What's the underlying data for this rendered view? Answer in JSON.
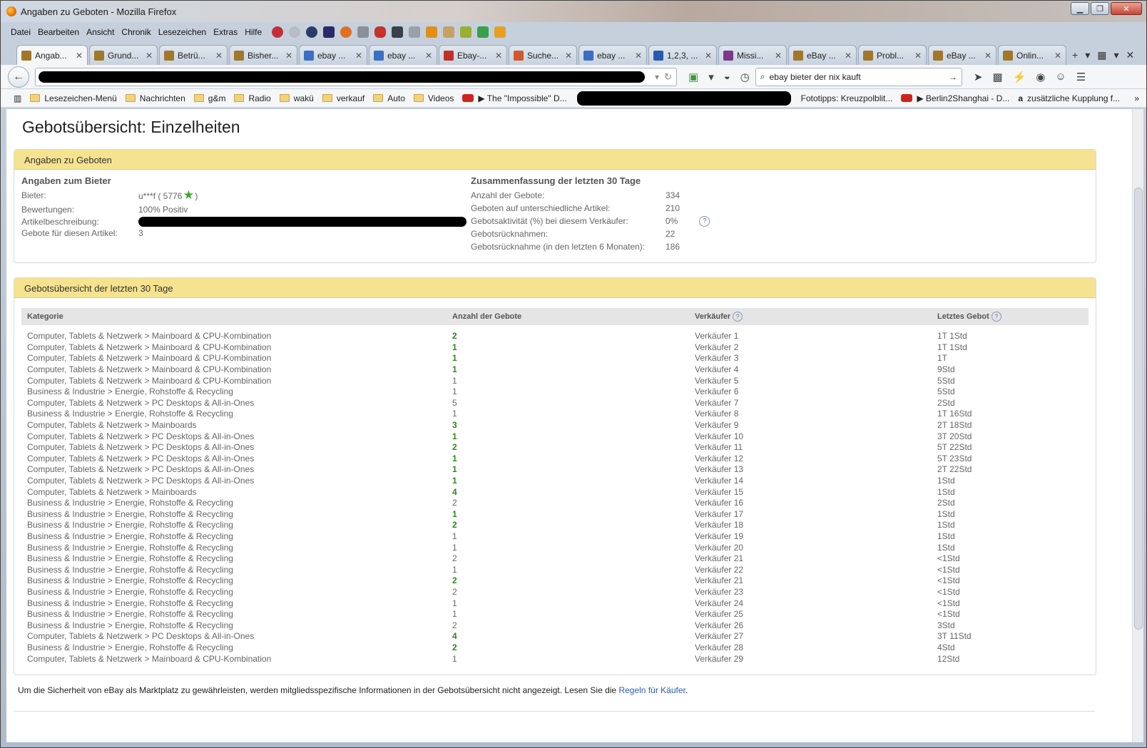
{
  "window": {
    "title": "Angaben zu Geboten - Mozilla Firefox"
  },
  "menu": [
    "Datei",
    "Bearbeiten",
    "Ansicht",
    "Chronik",
    "Lesezeichen",
    "Extras",
    "Hilfe"
  ],
  "tabs": [
    {
      "label": "Angab...",
      "color": "#a0782a",
      "active": true
    },
    {
      "label": "Grund...",
      "color": "#a0782a"
    },
    {
      "label": "Betrü...",
      "color": "#a0782a"
    },
    {
      "label": "Bisher...",
      "color": "#a0782a"
    },
    {
      "label": "ebay ...",
      "color": "#3a6fc4"
    },
    {
      "label": "ebay ...",
      "color": "#3a6fc4"
    },
    {
      "label": "Ebay-...",
      "color": "#c0302a"
    },
    {
      "label": "Suche...",
      "color": "#d05a2a"
    },
    {
      "label": "ebay ...",
      "color": "#3a6fc4"
    },
    {
      "label": "1,2,3, ...",
      "color": "#2a5ab0"
    },
    {
      "label": "Missi...",
      "color": "#7a3a8a"
    },
    {
      "label": "eBay ...",
      "color": "#a0782a"
    },
    {
      "label": "Probl...",
      "color": "#a0782a"
    },
    {
      "label": "eBay ...",
      "color": "#a0782a"
    },
    {
      "label": "Onlin...",
      "color": "#a0782a"
    }
  ],
  "search": {
    "value": "ebay bieter der nix kauft"
  },
  "bookmarks": [
    {
      "label": "Lesezeichen-Menü",
      "type": "folder"
    },
    {
      "label": "Nachrichten",
      "type": "folder"
    },
    {
      "label": "g&m",
      "type": "folder"
    },
    {
      "label": "Radio",
      "type": "folder"
    },
    {
      "label": "wakü",
      "type": "folder"
    },
    {
      "label": "verkauf",
      "type": "folder"
    },
    {
      "label": "Auto",
      "type": "folder"
    },
    {
      "label": "Videos",
      "type": "folder"
    },
    {
      "label": "▶ The \"Impossible\" D...",
      "type": "youtube"
    }
  ],
  "bookmarks_right": [
    {
      "label": "Fototipps: Kreuzpolblit...",
      "type": "plain"
    },
    {
      "label": "▶ Berlin2Shanghai - D...",
      "type": "youtube"
    },
    {
      "label": "zusätzliche Kupplung f...",
      "type": "amazon"
    }
  ],
  "page": {
    "title": "Gebotsübersicht: Einzelheiten",
    "panel1_title": "Angaben zu Geboten",
    "bidder": {
      "heading": "Angaben zum Bieter",
      "bieter_label": "Bieter:",
      "bieter_value": "u***f ( 5776",
      "bieter_close": ")",
      "bewertungen_label": "Bewertungen:",
      "bewertungen_value": "100% Positiv",
      "artikel_label": "Artikelbeschreibung:",
      "gebote_label": "Gebote für diesen Artikel:",
      "gebote_value": "3"
    },
    "summary": {
      "heading": "Zusammenfassung der letzten 30 Tage",
      "rows": [
        {
          "label": "Anzahl der Gebote:",
          "value": "334"
        },
        {
          "label": "Geboten auf unterschiedliche Artikel:",
          "value": "210"
        },
        {
          "label": "Gebotsaktivität (%) bei diesem Verkäufer:",
          "value": "0%"
        },
        {
          "label": "Gebotsrücknahmen:",
          "value": "22"
        },
        {
          "label": "Gebotsrücknahme (in den letzten 6 Monaten):",
          "value": "186"
        }
      ]
    },
    "panel2_title": "Gebotsübersicht der letzten 30 Tage",
    "table": {
      "headers": [
        "Kategorie",
        "Anzahl der Gebote",
        "Verkäufer",
        "Letztes Gebot"
      ],
      "rows": [
        [
          "Computer, Tablets & Netzwerk > Mainboard & CPU-Kombination",
          "2",
          "Verkäufer 1",
          "1T 1Std",
          true
        ],
        [
          "Computer, Tablets & Netzwerk > Mainboard & CPU-Kombination",
          "1",
          "Verkäufer 2",
          "1T 1Std",
          true
        ],
        [
          "Computer, Tablets & Netzwerk > Mainboard & CPU-Kombination",
          "1",
          "Verkäufer 3",
          "1T",
          true
        ],
        [
          "Computer, Tablets & Netzwerk > Mainboard & CPU-Kombination",
          "1",
          "Verkäufer 4",
          "9Std",
          true
        ],
        [
          "Computer, Tablets & Netzwerk > Mainboard & CPU-Kombination",
          "1",
          "Verkäufer 5",
          "5Std",
          false
        ],
        [
          "Business & Industrie > Energie, Rohstoffe & Recycling",
          "1",
          "Verkäufer 6",
          "5Std",
          false
        ],
        [
          "Computer, Tablets & Netzwerk > PC Desktops & All-in-Ones",
          "5",
          "Verkäufer 7",
          "2Std",
          false
        ],
        [
          "Business & Industrie > Energie, Rohstoffe & Recycling",
          "1",
          "Verkäufer 8",
          "1T 16Std",
          false
        ],
        [
          "Computer, Tablets & Netzwerk > Mainboards",
          "3",
          "Verkäufer 9",
          "2T 18Std",
          true
        ],
        [
          "Computer, Tablets & Netzwerk > PC Desktops & All-in-Ones",
          "1",
          "Verkäufer 10",
          "3T 20Std",
          true
        ],
        [
          "Computer, Tablets & Netzwerk > PC Desktops & All-in-Ones",
          "2",
          "Verkäufer 11",
          "5T 22Std",
          true
        ],
        [
          "Computer, Tablets & Netzwerk > PC Desktops & All-in-Ones",
          "1",
          "Verkäufer 12",
          "5T 23Std",
          true
        ],
        [
          "Computer, Tablets & Netzwerk > PC Desktops & All-in-Ones",
          "1",
          "Verkäufer 13",
          "2T 22Std",
          true
        ],
        [
          "Computer, Tablets & Netzwerk > PC Desktops & All-in-Ones",
          "1",
          "Verkäufer 14",
          "1Std",
          true
        ],
        [
          "Computer, Tablets & Netzwerk > Mainboards",
          "4",
          "Verkäufer 15",
          "1Std",
          true
        ],
        [
          "Business & Industrie > Energie, Rohstoffe & Recycling",
          "2",
          "Verkäufer 16",
          "2Std",
          false
        ],
        [
          "Business & Industrie > Energie, Rohstoffe & Recycling",
          "1",
          "Verkäufer 17",
          "1Std",
          true
        ],
        [
          "Business & Industrie > Energie, Rohstoffe & Recycling",
          "2",
          "Verkäufer 18",
          "1Std",
          true
        ],
        [
          "Business & Industrie > Energie, Rohstoffe & Recycling",
          "1",
          "Verkäufer 19",
          "1Std",
          false
        ],
        [
          "Business & Industrie > Energie, Rohstoffe & Recycling",
          "1",
          "Verkäufer 20",
          "1Std",
          false
        ],
        [
          "Business & Industrie > Energie, Rohstoffe & Recycling",
          "2",
          "Verkäufer 21",
          "<1Std",
          false
        ],
        [
          "Business & Industrie > Energie, Rohstoffe & Recycling",
          "1",
          "Verkäufer 22",
          "<1Std",
          false
        ],
        [
          "Business & Industrie > Energie, Rohstoffe & Recycling",
          "2",
          "Verkäufer 21",
          "<1Std",
          true
        ],
        [
          "Business & Industrie > Energie, Rohstoffe & Recycling",
          "2",
          "Verkäufer 23",
          "<1Std",
          false
        ],
        [
          "Business & Industrie > Energie, Rohstoffe & Recycling",
          "1",
          "Verkäufer 24",
          "<1Std",
          false
        ],
        [
          "Business & Industrie > Energie, Rohstoffe & Recycling",
          "1",
          "Verkäufer 25",
          "<1Std",
          false
        ],
        [
          "Business & Industrie > Energie, Rohstoffe & Recycling",
          "2",
          "Verkäufer 26",
          "3Std",
          false
        ],
        [
          "Computer, Tablets & Netzwerk > PC Desktops & All-in-Ones",
          "4",
          "Verkäufer 27",
          "3T 11Std",
          true
        ],
        [
          "Business & Industrie > Energie, Rohstoffe & Recycling",
          "2",
          "Verkäufer 28",
          "4Std",
          true
        ],
        [
          "Computer, Tablets & Netzwerk > Mainboard & CPU-Kombination",
          "1",
          "Verkäufer 29",
          "12Std",
          false
        ]
      ]
    },
    "footer": {
      "text": "Um die Sicherheit von eBay als Marktplatz zu gewährleisten, werden mitgliedsspezifische Informationen in der Gebotsübersicht nicht angezeigt. Lesen Sie die ",
      "link": "Regeln für Käufer",
      "end": "."
    }
  }
}
